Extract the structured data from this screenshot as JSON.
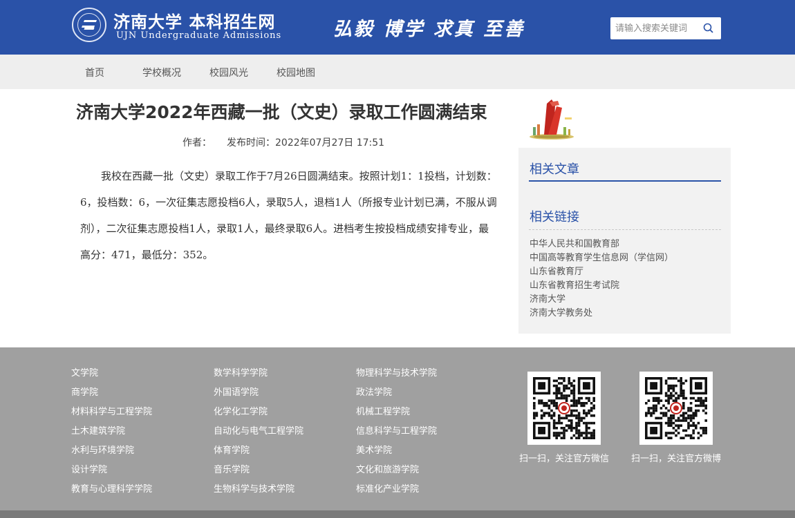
{
  "header": {
    "logo_cn": "济南大学 本科招生网",
    "logo_en": "UJN Undergraduate Admissions",
    "motto": "弘毅 博学 求真 至善",
    "search_placeholder": "请输入搜索关键词",
    "color": "#2a52a8"
  },
  "nav": {
    "items": [
      {
        "label": "首页"
      },
      {
        "label": "学校概况"
      },
      {
        "label": "校园风光"
      },
      {
        "label": "校园地图"
      }
    ]
  },
  "article": {
    "title": "济南大学2022年西藏一批（文史）录取工作圆满结束",
    "author_label": "作者：",
    "publish_label": "发布时间：2022年07月27日 17:51",
    "body": "我校在西藏一批（文史）录取工作于7月26日圆满结束。按照计划1：1投档，计划数：6，投档数：6，一次征集志愿投档6人，录取5人，退档1人（所报专业计划已满，不服从调剂），二次征集志愿投档1人，录取1人，最终录取6人。进档考生按投档成绩安排专业，最高分：471，最低分：352。"
  },
  "sidebar": {
    "related_articles_title": "相关文章",
    "related_links_title": "相关链接",
    "links": [
      "中华人民共和国教育部",
      "中国高等教育学生信息网（学信网）",
      "山东省教育厅",
      "山东省教育招生考试院",
      "济南大学",
      "济南大学教务处"
    ]
  },
  "footer": {
    "colleges": [
      [
        "文学院",
        "商学院",
        "材料科学与工程学院",
        "土木建筑学院",
        "水利与环境学院",
        "设计学院",
        "教育与心理科学学院"
      ],
      [
        "数学科学学院",
        "外国语学院",
        "化学化工学院",
        "自动化与电气工程学院",
        "体育学院",
        "音乐学院",
        "生物科学与技术学院"
      ],
      [
        "物理科学与技术学院",
        "政法学院",
        "机械工程学院",
        "信息科学与工程学院",
        "美术学院",
        "文化和旅游学院",
        "标准化产业学院"
      ]
    ],
    "qr_wechat_caption": "扫一扫，关注官方微信",
    "qr_weibo_caption": "扫一扫，关注官方微博"
  }
}
